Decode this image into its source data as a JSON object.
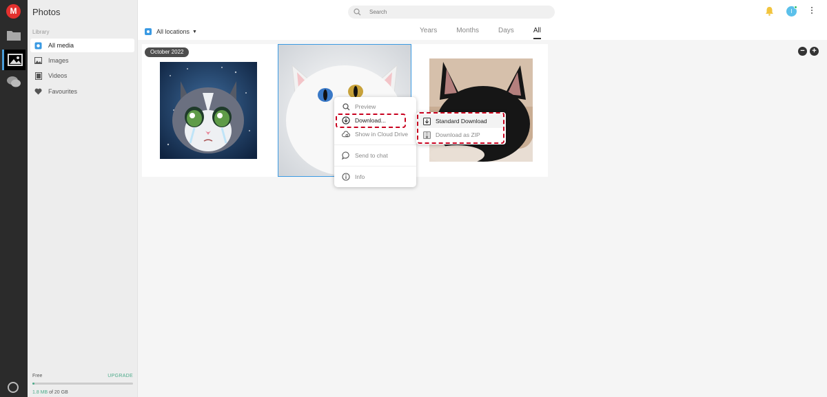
{
  "app": {
    "logo_letter": "M"
  },
  "sidebar": {
    "title": "Photos",
    "section_label": "Library",
    "items": [
      {
        "label": "All media",
        "icon": "camera-icon",
        "active": true
      },
      {
        "label": "Images",
        "icon": "image-icon",
        "active": false
      },
      {
        "label": "Videos",
        "icon": "video-icon",
        "active": false
      },
      {
        "label": "Favourites",
        "icon": "heart-icon",
        "active": false
      }
    ],
    "storage": {
      "plan": "Free",
      "upgrade_label": "UPGRADE",
      "used": "1.8 MB",
      "of_total": " of 20 GB",
      "usage_fraction": 0.0001
    }
  },
  "topbar": {
    "search_placeholder": "Search",
    "avatar_initial": "I",
    "location_selector": "All locations",
    "tabs": [
      {
        "label": "Years",
        "active": false
      },
      {
        "label": "Months",
        "active": false
      },
      {
        "label": "Days",
        "active": false
      },
      {
        "label": "All",
        "active": true
      }
    ]
  },
  "gallery": {
    "date_group": "October 2022",
    "zoom_out": "−",
    "zoom_in": "+"
  },
  "context_menu": {
    "items": [
      {
        "label": "Preview",
        "icon": "magnifier-icon"
      },
      {
        "label": "Download...",
        "icon": "download-circle-icon"
      },
      {
        "label": "Show in Cloud Drive",
        "icon": "cloud-search-icon"
      },
      {
        "label": "Send to chat",
        "icon": "chat-icon"
      },
      {
        "label": "Info",
        "icon": "info-icon"
      }
    ],
    "submenu": [
      {
        "label": "Standard Download",
        "icon": "download-box-icon"
      },
      {
        "label": "Download as ZIP",
        "icon": "zip-icon"
      }
    ]
  },
  "colors": {
    "brand": "#e4312f",
    "accent": "#4dab8a",
    "selection": "#3a9ae3",
    "highlight_annotation": "#c8001e"
  }
}
